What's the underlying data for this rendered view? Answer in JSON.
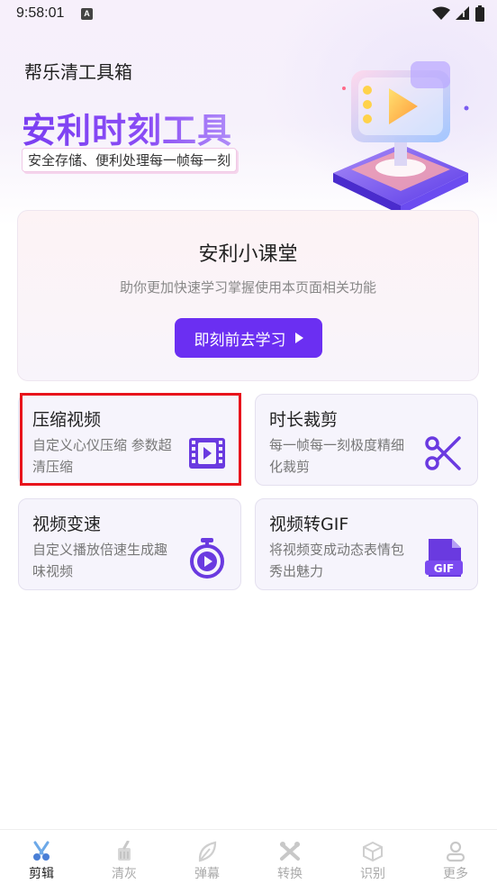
{
  "status_bar": {
    "time": "9:58:01",
    "a_badge": "A"
  },
  "header": {
    "app_title": "帮乐清工具箱",
    "hero_title": "安利时刻工具",
    "hero_subtitle": "安全存储、便利处理每一帧每一刻"
  },
  "course": {
    "title": "安利小课堂",
    "description": "助你更加快速学习掌握使用本页面相关功能",
    "button_label": "即刻前去学习"
  },
  "tools": [
    {
      "title": "压缩视频",
      "desc": "自定义心仪压缩 参数超清压缩",
      "icon": "video-compress-icon"
    },
    {
      "title": "时长裁剪",
      "desc": "每一帧每一刻极度精细化裁剪",
      "icon": "scissors-icon"
    },
    {
      "title": "视频变速",
      "desc": "自定义播放倍速生成趣味视频",
      "icon": "stopwatch-icon"
    },
    {
      "title": "视频转GIF",
      "desc": "将视频变成动态表情包秀出魅力",
      "icon": "gif-file-icon",
      "badge": "GIF"
    }
  ],
  "bottom_nav": {
    "items": [
      {
        "label": "剪辑",
        "icon": "scissors-nav-icon",
        "active": true
      },
      {
        "label": "清灰",
        "icon": "broom-icon",
        "active": false
      },
      {
        "label": "弹幕",
        "icon": "leaf-icon",
        "active": false
      },
      {
        "label": "转换",
        "icon": "tools-icon",
        "active": false
      },
      {
        "label": "识别",
        "icon": "cube-icon",
        "active": false
      },
      {
        "label": "更多",
        "icon": "user-icon",
        "active": false
      }
    ]
  },
  "colors": {
    "accent": "#6b2ff2",
    "highlight": "#e8141c",
    "icon_purple": "#6a3ae0"
  }
}
